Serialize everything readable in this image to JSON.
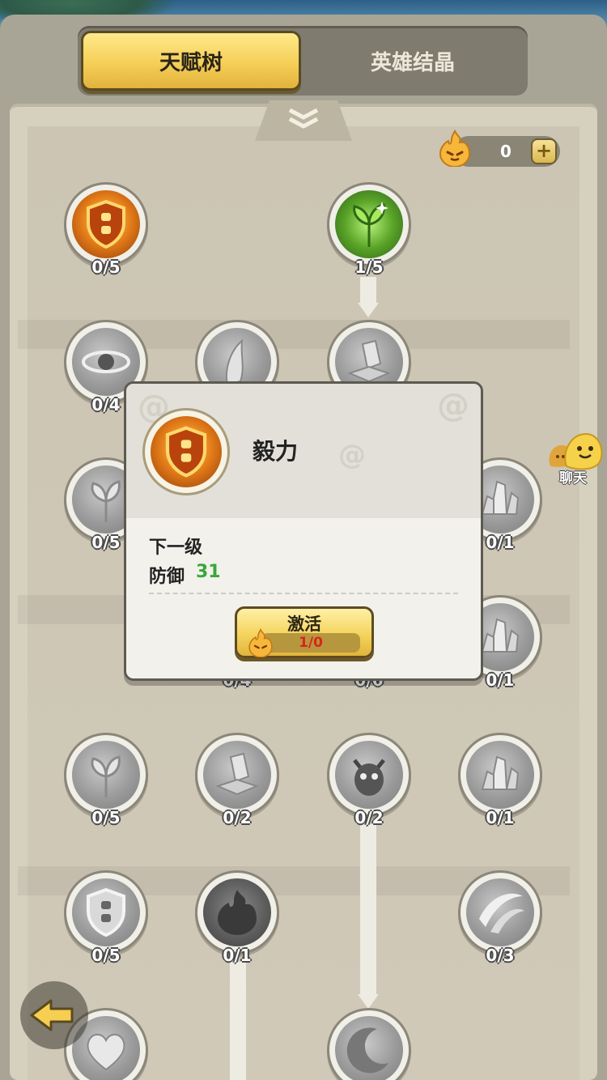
{
  "tabs": [
    {
      "label": "天赋树",
      "active": true
    },
    {
      "label": "英雄结晶",
      "active": false
    }
  ],
  "currency": {
    "icon": "flame-spirit-icon",
    "value": "0",
    "add_icon": "plus-icon"
  },
  "nodes": [
    {
      "id": "r1c1",
      "icon": "shield-icon",
      "level": "0/5",
      "state": "gold"
    },
    {
      "id": "r1c3",
      "icon": "sprout-icon",
      "level": "1/5",
      "state": "green"
    },
    {
      "id": "r2c1",
      "icon": "vortex-icon",
      "level": "0/4",
      "state": "locked"
    },
    {
      "id": "r2c2",
      "icon": "feather-icon",
      "level": "",
      "state": "locked"
    },
    {
      "id": "r2c3",
      "icon": "crystal-icon",
      "level": "",
      "state": "locked"
    },
    {
      "id": "r3c1",
      "icon": "leaf-icon",
      "level": "0/5",
      "state": "locked"
    },
    {
      "id": "r3c4",
      "icon": "crystal-cluster-icon",
      "level": "0/1",
      "state": "locked"
    },
    {
      "id": "r4c2",
      "icon": "hidden",
      "level": "0/4",
      "state": "locked"
    },
    {
      "id": "r4c3",
      "icon": "hidden",
      "level": "0/6",
      "state": "locked"
    },
    {
      "id": "r4c4",
      "icon": "crystal-cluster-icon",
      "level": "0/1",
      "state": "locked"
    },
    {
      "id": "r5c1",
      "icon": "leaf-icon",
      "level": "0/5",
      "state": "locked"
    },
    {
      "id": "r5c2",
      "icon": "crystal-icon",
      "level": "0/2",
      "state": "locked"
    },
    {
      "id": "r5c3",
      "icon": "demon-icon",
      "level": "0/2",
      "state": "locked"
    },
    {
      "id": "r5c4",
      "icon": "crystal-cluster-icon",
      "level": "0/1",
      "state": "locked"
    },
    {
      "id": "r6c1",
      "icon": "shield-icon",
      "level": "0/5",
      "state": "locked"
    },
    {
      "id": "r6c2",
      "icon": "flame-spirit-icon",
      "level": "0/1",
      "state": "locked"
    },
    {
      "id": "r6c4",
      "icon": "slash-icon",
      "level": "0/3",
      "state": "locked"
    },
    {
      "id": "r7c1",
      "icon": "heart-icon",
      "level": "",
      "state": "locked"
    },
    {
      "id": "r7c3",
      "icon": "moon-icon",
      "level": "",
      "state": "locked"
    }
  ],
  "chat": {
    "label": "聊天",
    "icon": "chat-bubble-icon"
  },
  "back": {
    "icon": "back-arrow-icon"
  },
  "popup": {
    "title": "毅力",
    "icon": "shield-icon",
    "next_level_label": "下一级",
    "stat_label": "防御",
    "stat_value": "31",
    "button_label": "激活",
    "cost": "1/0",
    "colors": {
      "stat": "#3aa63a",
      "cost": "#d9251b"
    }
  }
}
